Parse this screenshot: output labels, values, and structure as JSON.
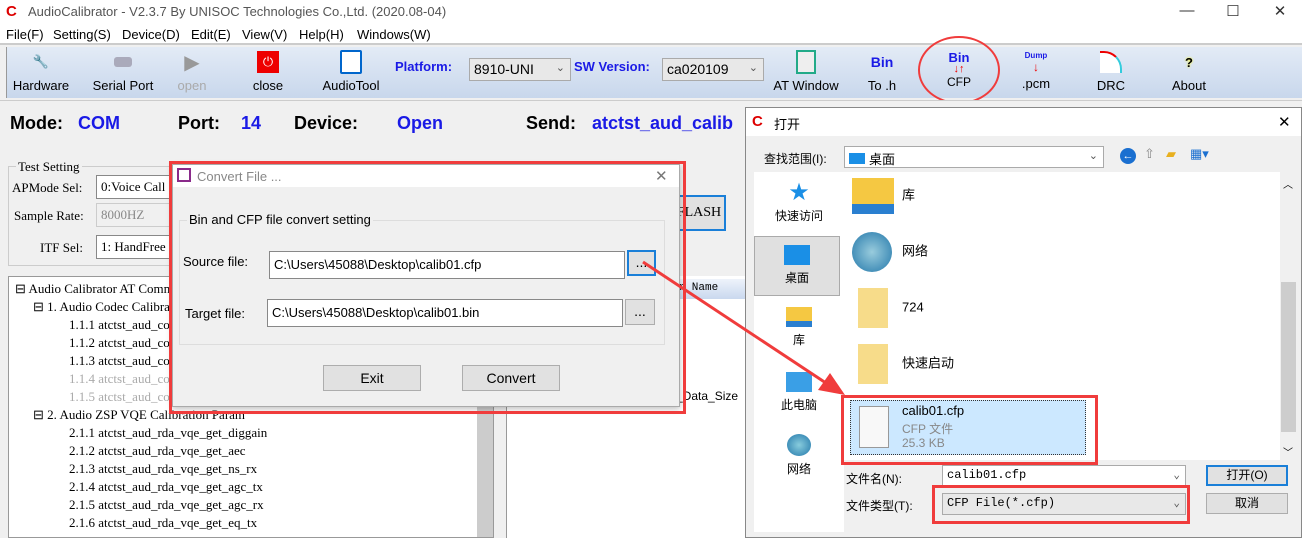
{
  "window": {
    "title": "AudioCalibrator - V2.3.7 By UNISOC Technologies Co.,Ltd. (2020.08-04)",
    "controls": [
      "minimize",
      "maximize",
      "close"
    ]
  },
  "menu": [
    "File(F)",
    "Setting(S)",
    "Device(D)",
    "Edit(E)",
    "View(V)",
    "Help(H)",
    "Windows(W)"
  ],
  "toolbar": {
    "hardware": "Hardware",
    "serial_port": "Serial Port",
    "open": "open",
    "close": "close",
    "audiotool": "AudioTool",
    "platform_label": "Platform:",
    "platform_value": "8910-UNI",
    "sw_label": "SW Version:",
    "sw_value": "ca020109",
    "at_window": "AT Window",
    "bin_to_h_top": "Bin",
    "bin_to_h": "To .h",
    "bin_cfp_top": "Bin",
    "bin_cfp": "CFP",
    "dump_top": "Dump",
    "dump_pcm": ".pcm",
    "drc": "DRC",
    "about": "About"
  },
  "status": {
    "mode_label": "Mode:",
    "mode": "COM",
    "port_label": "Port:",
    "port": "14",
    "device_label": "Device:",
    "device": "Open",
    "send_label": "Send:",
    "send": "atctst_aud_calib"
  },
  "test_setting": {
    "title": "Test Setting",
    "apmode_label": "APMode Sel:",
    "apmode": "0:Voice Call N",
    "sample_label": "Sample Rate:",
    "sample": "8000HZ",
    "itf_label": "ITF Sel:",
    "itf": "1: HandFree",
    "flash_btn": "FLASH"
  },
  "tree": [
    {
      "label": "Audio Calibrator AT Comm",
      "level": 0,
      "dim": false
    },
    {
      "label": "1. Audio Codec Calibra",
      "level": 1,
      "dim": false
    },
    {
      "label": "1.1.1 atctst_aud_co",
      "level": 2,
      "dim": false
    },
    {
      "label": "1.1.2 atctst_aud_co",
      "level": 2,
      "dim": false
    },
    {
      "label": "1.1.3 atctst_aud_co",
      "level": 2,
      "dim": false
    },
    {
      "label": "1.1.4 atctst_aud_co",
      "level": 2,
      "dim": true
    },
    {
      "label": "1.1.5 atctst_aud_co",
      "level": 2,
      "dim": true
    },
    {
      "label": "2. Audio ZSP VQE Calibration Param",
      "level": 1,
      "dim": false
    },
    {
      "label": "2.1.1 atctst_aud_rda_vqe_get_diggain",
      "level": 2,
      "dim": false
    },
    {
      "label": "2.1.2 atctst_aud_rda_vqe_get_aec",
      "level": 2,
      "dim": false
    },
    {
      "label": "2.1.3 atctst_aud_rda_vqe_get_ns_rx",
      "level": 2,
      "dim": false
    },
    {
      "label": "2.1.4 atctst_aud_rda_vqe_get_agc_tx",
      "level": 2,
      "dim": false
    },
    {
      "label": "2.1.5 atctst_aud_rda_vqe_get_agc_rx",
      "level": 2,
      "dim": false
    },
    {
      "label": "2.1.6 atctst_aud_rda_vqe_get_eq_tx",
      "level": 2,
      "dim": false
    }
  ],
  "param_list": {
    "header": "er Name",
    "row": "r_Data_Size"
  },
  "convert_dialog": {
    "title": "Convert File ...",
    "group": "Bin and CFP file convert setting",
    "source_label": "Source file:",
    "source_value": "C:\\Users\\45088\\Desktop\\calib01.cfp",
    "target_label": "Target file:",
    "target_value": "C:\\Users\\45088\\Desktop\\calib01.bin",
    "browse": "...",
    "exit": "Exit",
    "convert": "Convert"
  },
  "open_dialog": {
    "title": "打开",
    "lookin_label": "查找范围(I):",
    "lookin_value": "桌面",
    "places": [
      "快速访问",
      "桌面",
      "库",
      "此电脑",
      "网络"
    ],
    "files": [
      {
        "name": "库"
      },
      {
        "name": "网络"
      },
      {
        "name": "724"
      },
      {
        "name": "快速启动"
      }
    ],
    "selected_file": {
      "name": "calib01.cfp",
      "type": "CFP 文件",
      "size": "25.3 KB"
    },
    "filename_label": "文件名(N):",
    "filename_value": "calib01.cfp",
    "filetype_label": "文件类型(T):",
    "filetype_value": "CFP File(*.cfp)",
    "open_btn": "打开(O)",
    "cancel_btn": "取消"
  },
  "colors": {
    "accent_blue": "#1a1ae6",
    "annotation_red": "#f03c3c",
    "selection": "#cce8ff"
  }
}
